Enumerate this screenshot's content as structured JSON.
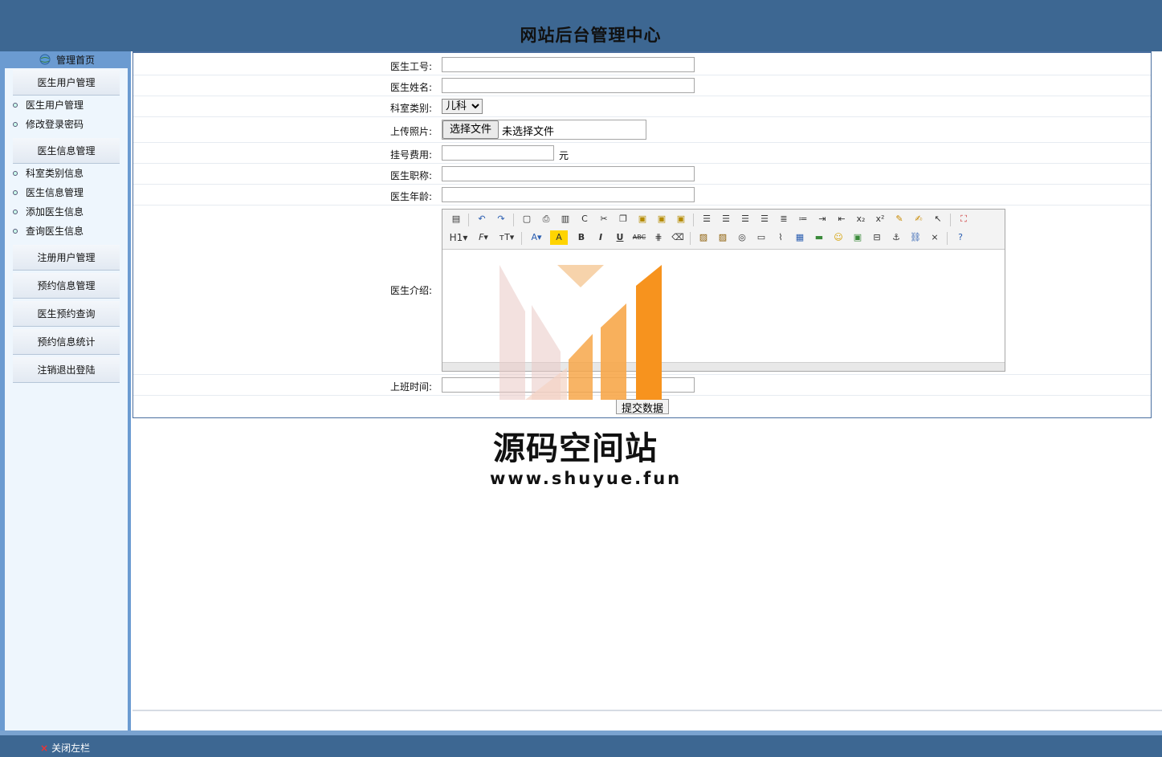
{
  "header": {
    "title": "网站后台管理中心"
  },
  "sidebar": {
    "home": "管理首页",
    "groups": [
      {
        "head": "医生用户管理",
        "items": [
          "医生用户管理",
          "修改登录密码"
        ]
      },
      {
        "head": "医生信息管理",
        "items": [
          "科室类别信息",
          "医生信息管理",
          "添加医生信息",
          "查询医生信息"
        ]
      },
      {
        "head": "注册用户管理",
        "items": []
      },
      {
        "head": "预约信息管理",
        "items": []
      },
      {
        "head": "医生预约查询",
        "items": []
      },
      {
        "head": "预约信息统计",
        "items": []
      },
      {
        "head": "注销退出登陆",
        "items": []
      }
    ]
  },
  "form": {
    "doctor_id_label": "医生工号:",
    "doctor_name_label": "医生姓名:",
    "department_label": "科室类别:",
    "department_value": "儿科",
    "photo_label": "上传照片:",
    "file_button": "选择文件",
    "file_status": "未选择文件",
    "fee_label": "挂号费用:",
    "fee_unit": "元",
    "title_label": "医生职称:",
    "age_label": "医生年龄:",
    "intro_label": "医生介绍:",
    "work_time_label": "上班时间:",
    "submit_label": "提交数据"
  },
  "watermark": {
    "name": "源码空间站",
    "url": "www.shuyue.fun"
  },
  "footer": {
    "close_label": "关闭左栏"
  },
  "colors": {
    "header_bg": "#3d6792",
    "sidebar_bg": "#6b9bd1",
    "sidebar_inner": "#eef6fd",
    "watermark_orange": "#f7931e"
  }
}
